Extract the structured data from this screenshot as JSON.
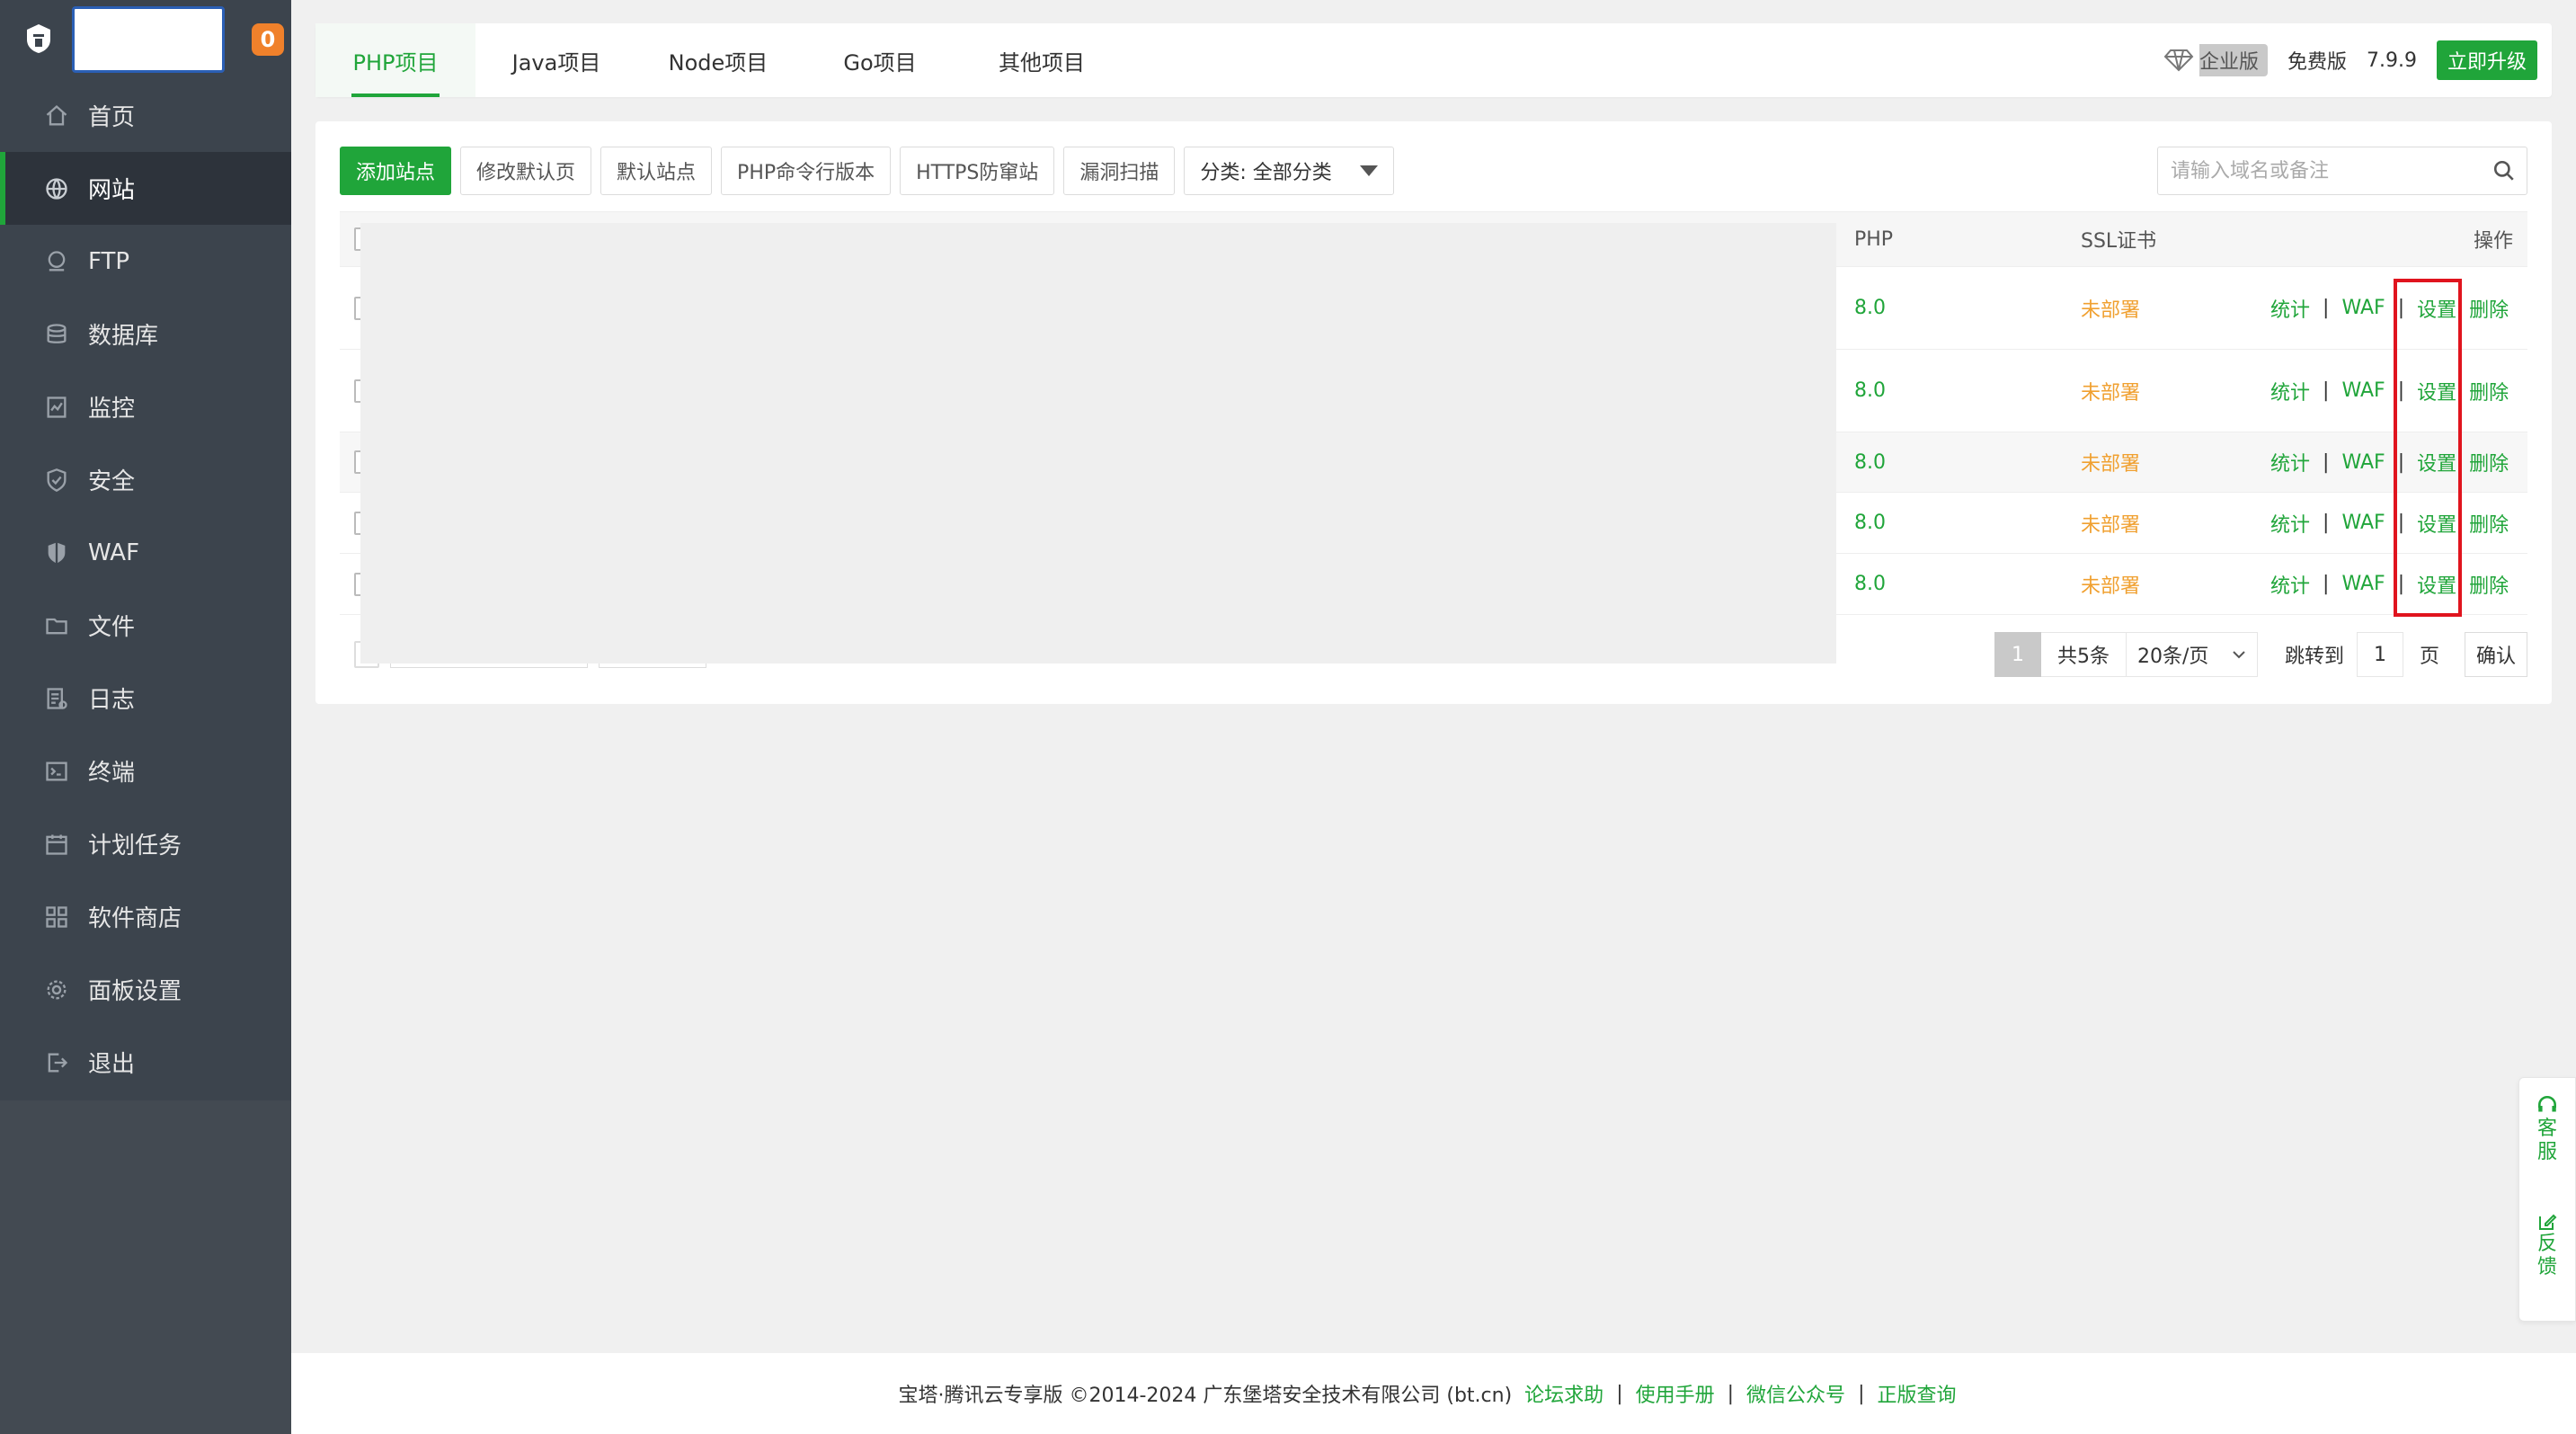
{
  "sidebar": {
    "notice_count": "0",
    "items": [
      {
        "label": "首页",
        "icon": "home-icon"
      },
      {
        "label": "网站",
        "icon": "globe-icon"
      },
      {
        "label": "FTP",
        "icon": "ftp-icon"
      },
      {
        "label": "数据库",
        "icon": "database-icon"
      },
      {
        "label": "监控",
        "icon": "monitor-icon"
      },
      {
        "label": "安全",
        "icon": "shield-check-icon"
      },
      {
        "label": "WAF",
        "icon": "shield-icon"
      },
      {
        "label": "文件",
        "icon": "folder-icon"
      },
      {
        "label": "日志",
        "icon": "log-icon"
      },
      {
        "label": "终端",
        "icon": "terminal-icon"
      },
      {
        "label": "计划任务",
        "icon": "calendar-icon"
      },
      {
        "label": "软件商店",
        "icon": "apps-icon"
      },
      {
        "label": "面板设置",
        "icon": "gear-icon"
      },
      {
        "label": "退出",
        "icon": "logout-icon"
      }
    ],
    "active_index": 1
  },
  "tabs": [
    "PHP项目",
    "Java项目",
    "Node项目",
    "Go项目",
    "其他项目"
  ],
  "header": {
    "enterprise_label": "企业版",
    "free_label": "免费版",
    "version": "7.9.9",
    "upgrade_label": "立即升级"
  },
  "toolbar": {
    "add_site": "添加站点",
    "modify_default_page": "修改默认页",
    "default_site": "默认站点",
    "php_cli_version": "PHP命令行版本",
    "https_anti_hijack": "HTTPS防窜站",
    "vuln_scan": "漏洞扫描",
    "category_select": "分类: 全部分类"
  },
  "search": {
    "placeholder": "请输入域名或备注"
  },
  "table": {
    "headers": {
      "php": "PHP",
      "ssl": "SSL证书",
      "ops": "操作"
    },
    "rows": [
      {
        "php": "8.0",
        "ssl": "未部署"
      },
      {
        "php": "8.0",
        "ssl": "未部署"
      },
      {
        "php": "8.0",
        "ssl": "未部署"
      },
      {
        "php": "8.0",
        "ssl": "未部署"
      },
      {
        "php": "8.0",
        "ssl": "未部署"
      }
    ],
    "ops": {
      "stats": "统计",
      "sep": "|",
      "waf": "WAF",
      "settings": "设置",
      "delete": "删除"
    }
  },
  "pagination": {
    "current": "1",
    "total": "共5条",
    "page_size": "20条/页",
    "jump_label": "跳转到",
    "jump_value": "1",
    "page_unit": "页",
    "confirm": "确认"
  },
  "float_help": {
    "service": "客服",
    "feedback": "反馈"
  },
  "footer": {
    "copyright": "宝塔·腾讯云专享版 ©2014-2024 广东堡塔安全技术有限公司 (bt.cn)",
    "links": [
      "论坛求助",
      "使用手册",
      "微信公众号",
      "正版查询"
    ],
    "sep": "|"
  },
  "colors": {
    "accent": "#20a53a",
    "sidebar_bg": "#3c444d",
    "warning": "#f0a030",
    "highlight_box": "#e0141e",
    "badge": "#f0812b"
  }
}
